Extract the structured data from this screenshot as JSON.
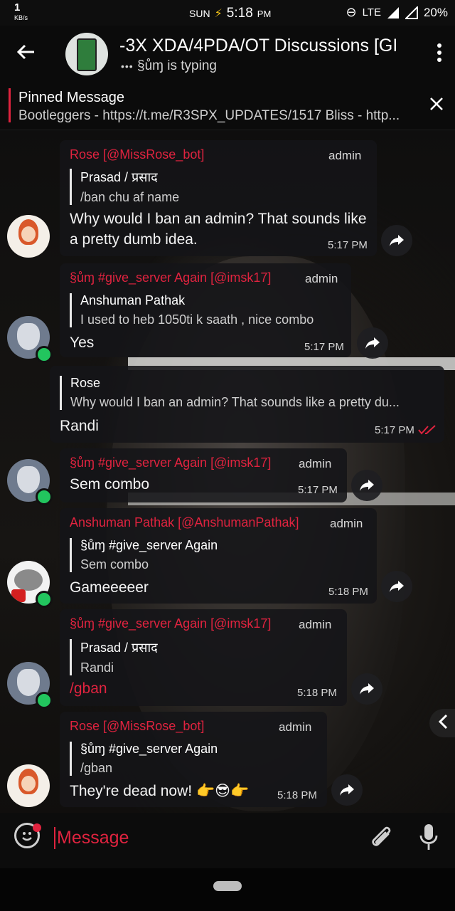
{
  "status_bar": {
    "network_speed": "1",
    "network_unit": "KB/s",
    "day": "SUN",
    "time": "5:18",
    "ampm": "PM",
    "network": "LTE",
    "battery": "20%"
  },
  "header": {
    "title": "-3X XDA/4PDA/OT Discussions [GI",
    "typing_user": "§ůɱ",
    "typing_text": "is typing"
  },
  "pinned": {
    "label": "Pinned Message",
    "text": "Bootleggers - https://t.me/R3SPX_UPDATES/1517 Bliss - http..."
  },
  "messages": [
    {
      "sender": "Rose [@MissRose_bot]",
      "role": "admin",
      "reply_name": "Prasad / प्रसाद",
      "reply_text": "/ban chu af name",
      "body": "Why would I ban an admin? That sounds like a pretty dumb idea.",
      "time": "5:17 PM"
    },
    {
      "sender": "§ůɱ #give_server Again [@imsk17]",
      "role": "admin",
      "reply_name": "Anshuman Pathak",
      "reply_text": "I used to heb 1050ti k saath , nice combo",
      "body": "Yes",
      "time": "5:17 PM"
    },
    {
      "reply_name": "Rose",
      "reply_text": "Why would I ban an admin? That sounds like a pretty du...",
      "body": "Randi",
      "time": "5:17 PM"
    },
    {
      "sender": "§ůɱ #give_server Again [@imsk17]",
      "role": "admin",
      "body": "Sem combo",
      "time": "5:17 PM"
    },
    {
      "sender": "Anshuman Pathak [@AnshumanPathak]",
      "role": "admin",
      "reply_name": "§ůɱ #give_server Again",
      "reply_text": "Sem combo",
      "body": "Gameeeeer",
      "time": "5:18 PM"
    },
    {
      "sender": "§ůɱ #give_server Again [@imsk17]",
      "role": "admin",
      "reply_name": "Prasad / प्रसाद",
      "reply_text": "Randi",
      "body": "/gban",
      "time": "5:18 PM"
    },
    {
      "sender": "Rose [@MissRose_bot]",
      "role": "admin",
      "reply_name": "§ůɱ #give_server Again",
      "reply_text": "/gban",
      "body": "They're dead now! 👉😎👉",
      "time": "5:18 PM"
    }
  ],
  "input": {
    "placeholder": "Message"
  },
  "colors": {
    "accent": "#e0233f",
    "online": "#22c55e",
    "bubble": "#141418"
  },
  "icons": [
    "back-arrow-icon",
    "more-vert-icon",
    "close-icon",
    "forward-icon",
    "emoji-icon",
    "attach-icon",
    "mic-icon",
    "read-check-icon",
    "chevron-left-icon"
  ]
}
